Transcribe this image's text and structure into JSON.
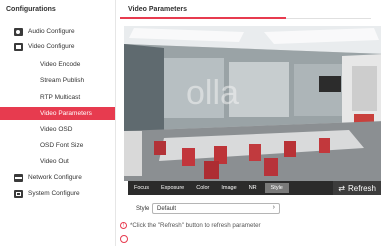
{
  "sidebar": {
    "title": "Configurations",
    "items": [
      {
        "label": "Audio Configure",
        "icon": "audio-icon"
      },
      {
        "label": "Video Configure",
        "icon": "video-icon"
      },
      {
        "label": "Video Encode"
      },
      {
        "label": "Stream Publish"
      },
      {
        "label": "RTP Multicast"
      },
      {
        "label": "Video Parameters",
        "active": true
      },
      {
        "label": "Video OSD"
      },
      {
        "label": "OSD Font Size"
      },
      {
        "label": "Video Out"
      },
      {
        "label": "Network Configure",
        "icon": "network-icon"
      },
      {
        "label": "System Configure",
        "icon": "system-icon"
      }
    ]
  },
  "main": {
    "title": "Video Parameters",
    "toolbar": {
      "tabs": [
        "Focus",
        "Exposure",
        "Color",
        "Image",
        "NR",
        "Style"
      ],
      "active_tab": "Style",
      "refresh_label": "Refresh"
    },
    "style": {
      "label": "Style",
      "value": "Default"
    },
    "note": "*Click the \"Refresh\" button to refresh parameter"
  },
  "colors": {
    "accent": "#e73b4f",
    "toolbar_bg": "#2b2b2b"
  }
}
